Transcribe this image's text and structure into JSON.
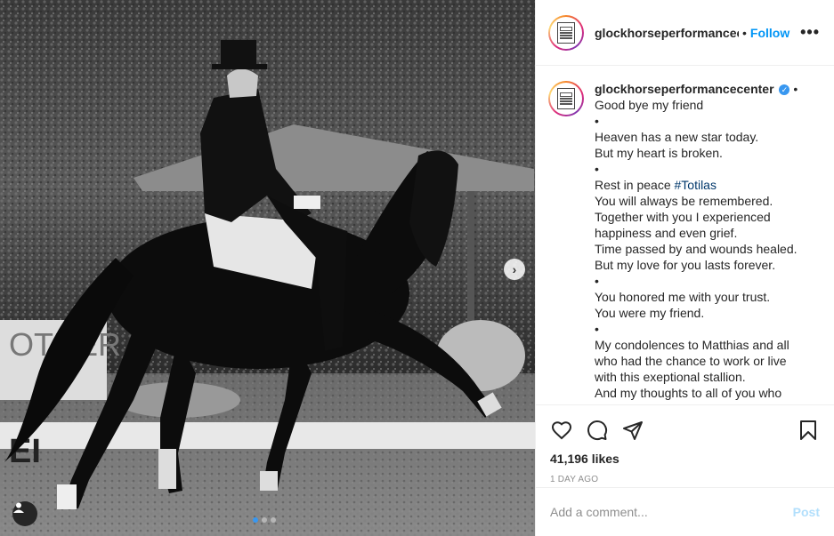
{
  "post": {
    "username": "glockhorseperformancecenter",
    "username_truncated": "glockhorseperformancece",
    "separator": "•",
    "follow_label": "Follow",
    "more_label": "•••",
    "caption_lines": [
      "Good bye my friend",
      "•",
      "Heaven has a new star today.",
      "But my heart is broken.",
      "•",
      "Rest in peace ",
      "You will always be remembered.",
      "Together with you I experienced",
      "happiness and even grief.",
      "Time passed by and wounds healed.",
      "But my love for you lasts forever.",
      "•",
      "You honored me with your trust.",
      "You were my friend.",
      "•",
      "My condolences to Matthias and all",
      "who had the chance to work or live",
      "with this exeptional stallion.",
      "And my thoughts to all of you who"
    ],
    "hashtag": "#Totilas",
    "caption_suffix": "•",
    "likes": "41,196 likes",
    "time_ago": "1 DAY AGO",
    "comment_placeholder": "Add a comment...",
    "post_label": "Post"
  },
  "icons": {
    "like": "heart-icon",
    "comment": "comment-icon",
    "share": "share-icon",
    "save": "bookmark-icon",
    "next": "chevron-right-icon",
    "tags": "user-tag-icon"
  },
  "colors": {
    "accent": "#0095f6",
    "verified": "#3897f0",
    "post_disabled": "#b2dffc",
    "hashtag": "#00376b"
  },
  "carousel": {
    "total": 3,
    "active": 1
  }
}
